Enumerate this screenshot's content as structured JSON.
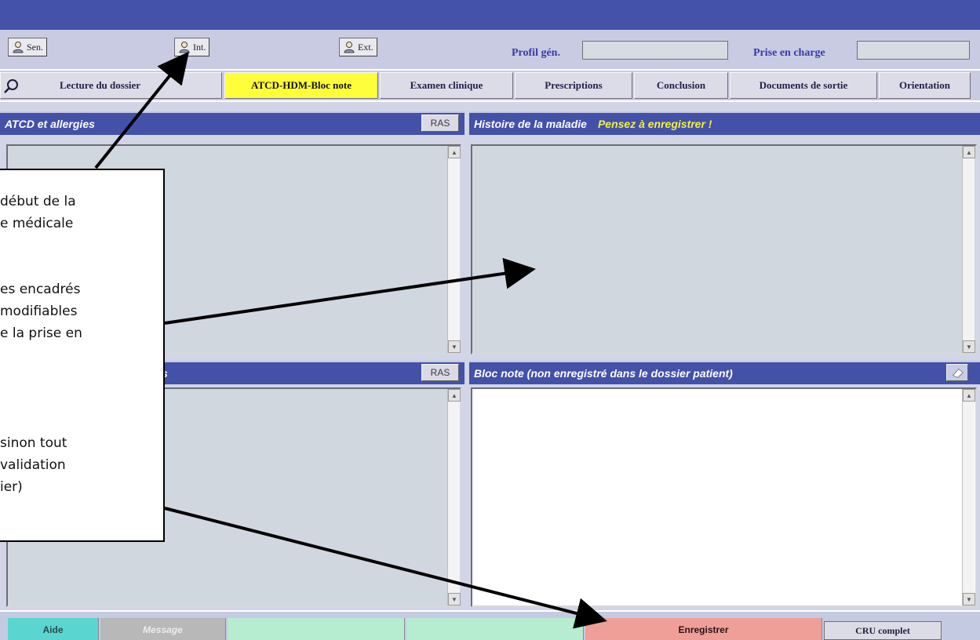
{
  "colors": {
    "title_bar": "#4452a8",
    "panel_header": "#4351a8",
    "active_tab": "#fffe3a",
    "warning_text": "#f3f23a",
    "aide": "#5ad5d0",
    "message": "#b8b8b8",
    "green": "#b6ecd0",
    "save": "#f09e98",
    "arrow": "#000000"
  },
  "toolbar": {
    "buttons": [
      {
        "label": "Sen.",
        "icon": "person-icon"
      },
      {
        "label": "Int.",
        "icon": "person-icon"
      },
      {
        "label": "Ext.",
        "icon": "person-icon"
      }
    ],
    "profile_label": "Profil gén.",
    "profile_value": "",
    "care_label": "Prise en charge",
    "care_value": ""
  },
  "tabs": [
    {
      "label": "Lecture du dossier",
      "icon": "search-icon"
    },
    {
      "label": "ATCD-HDM-Bloc note",
      "active": true
    },
    {
      "label": "Examen clinique"
    },
    {
      "label": "Prescriptions"
    },
    {
      "label": "Conclusion"
    },
    {
      "label": "Documents de sortie"
    },
    {
      "label": "Orientation"
    }
  ],
  "panels": {
    "atcd": {
      "title": "ATCD et allergies",
      "ras": "RAS",
      "value": ""
    },
    "histoire": {
      "title": "Histoire de la maladie",
      "warning": "Pensez à enregistrer !",
      "value": ""
    },
    "traitements": {
      "title": "s",
      "ras": "RAS",
      "value": ""
    },
    "bloc_note": {
      "title": "Bloc note (non enregistré dans le dossier patient)",
      "value": ""
    }
  },
  "footer": {
    "aide": "Aide",
    "message": "Message",
    "save": "Enregistrer",
    "cru": "CRU complet"
  },
  "callout": {
    "lines": [
      "début de la",
      "e médicale",
      "es encadrés",
      "modifiables",
      "e la prise en",
      "sinon tout",
      "validation",
      "ier)"
    ]
  }
}
